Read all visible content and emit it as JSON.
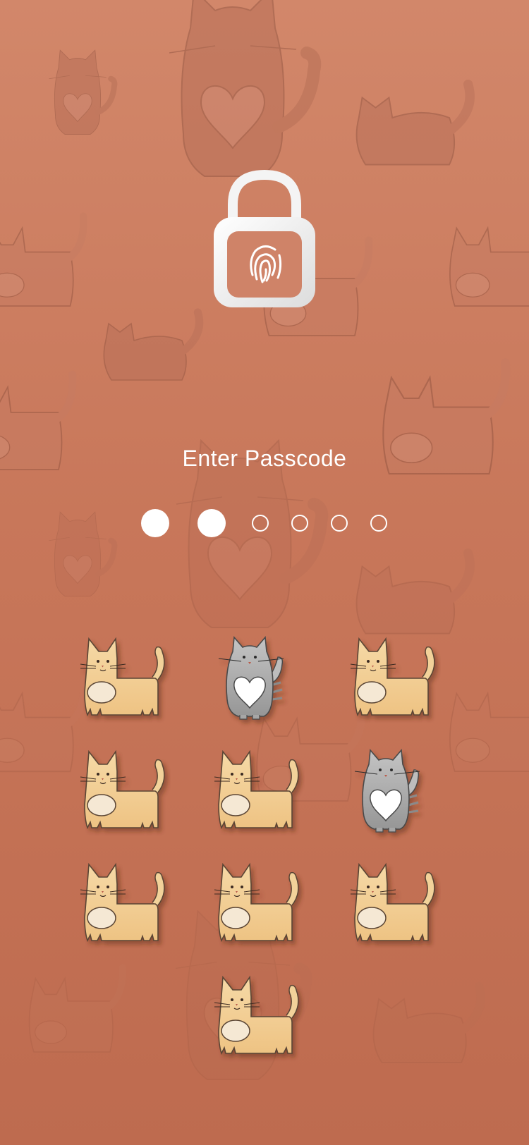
{
  "screen": {
    "title": "Enter Passcode"
  },
  "passcode": {
    "length": 6,
    "entered": 2
  },
  "lock": {
    "icon": "open-padlock-fingerprint-icon",
    "state": "unlocked"
  },
  "keypad": {
    "keys": [
      {
        "name": "keypad-key-1",
        "style": "beige-cat"
      },
      {
        "name": "keypad-key-2",
        "style": "gray-heart-cat"
      },
      {
        "name": "keypad-key-3",
        "style": "beige-cat"
      },
      {
        "name": "keypad-key-4",
        "style": "beige-cat"
      },
      {
        "name": "keypad-key-5",
        "style": "beige-cat"
      },
      {
        "name": "keypad-key-6",
        "style": "gray-heart-cat"
      },
      {
        "name": "keypad-key-7",
        "style": "beige-cat"
      },
      {
        "name": "keypad-key-8",
        "style": "beige-cat"
      },
      {
        "name": "keypad-key-9",
        "style": "beige-cat"
      },
      {
        "name": "keypad-key-0",
        "style": "beige-cat"
      }
    ]
  },
  "colors": {
    "background_top": "#d2876a",
    "background_bottom": "#be6b4f",
    "dot": "#ffffff",
    "beige_cat": "#f1cf95",
    "gray_cat": "#a6a6a6"
  }
}
